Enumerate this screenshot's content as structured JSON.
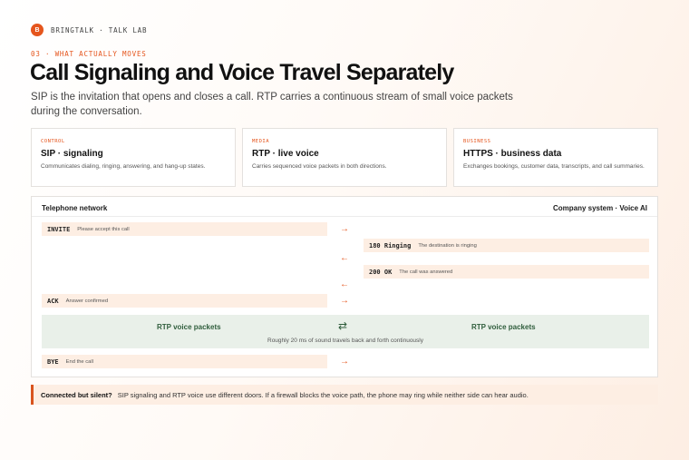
{
  "brand": {
    "logo": "B",
    "name": "BRINGTALK · TALK LAB"
  },
  "eyebrow": "03 · WHAT ACTUALLY MOVES",
  "title": "Call Signaling and Voice Travel Separately",
  "subtitle": "SIP is the invitation that opens and closes a call. RTP carries a continuous stream of small voice packets during the conversation.",
  "cards": [
    {
      "label": "CONTROL",
      "title": "SIP · signaling",
      "desc": "Communicates dialing, ringing, answering, and hang-up states."
    },
    {
      "label": "MEDIA",
      "title": "RTP · live voice",
      "desc": "Carries sequenced voice packets in both directions."
    },
    {
      "label": "BUSINESS",
      "title": "HTTPS · business data",
      "desc": "Exchanges bookings, customer data, transcripts, and call summaries."
    }
  ],
  "diagram": {
    "left_header": "Telephone network",
    "right_header": "Company system · Voice AI",
    "messages": [
      {
        "code": "INVITE",
        "desc": "Please accept this call",
        "side": "left",
        "arrow": "→"
      },
      {
        "code": "180 Ringing",
        "desc": "The destination is ringing",
        "side": "right",
        "arrow": "←"
      },
      {
        "code": "200 OK",
        "desc": "The call was answered",
        "side": "right",
        "arrow": "←"
      },
      {
        "code": "ACK",
        "desc": "Answer confirmed",
        "side": "left",
        "arrow": "→"
      },
      {
        "code": "BYE",
        "desc": "End the call",
        "side": "left",
        "arrow": "→"
      }
    ],
    "rtp": {
      "left": "RTP voice packets",
      "right": "RTP voice packets",
      "icon": "⇄",
      "note": "Roughly 20 ms of sound travels back and forth continuously"
    }
  },
  "callout": {
    "title": "Connected but silent?",
    "text": "SIP signaling and RTP voice use different doors. If a firewall blocks the voice path, the phone may ring while neither side can hear audio."
  },
  "colors": {
    "accent": "#e5551d",
    "tint": "#fdeee3",
    "rtp_bg": "#e9f0e9",
    "rtp_text": "#2f5d3c"
  }
}
